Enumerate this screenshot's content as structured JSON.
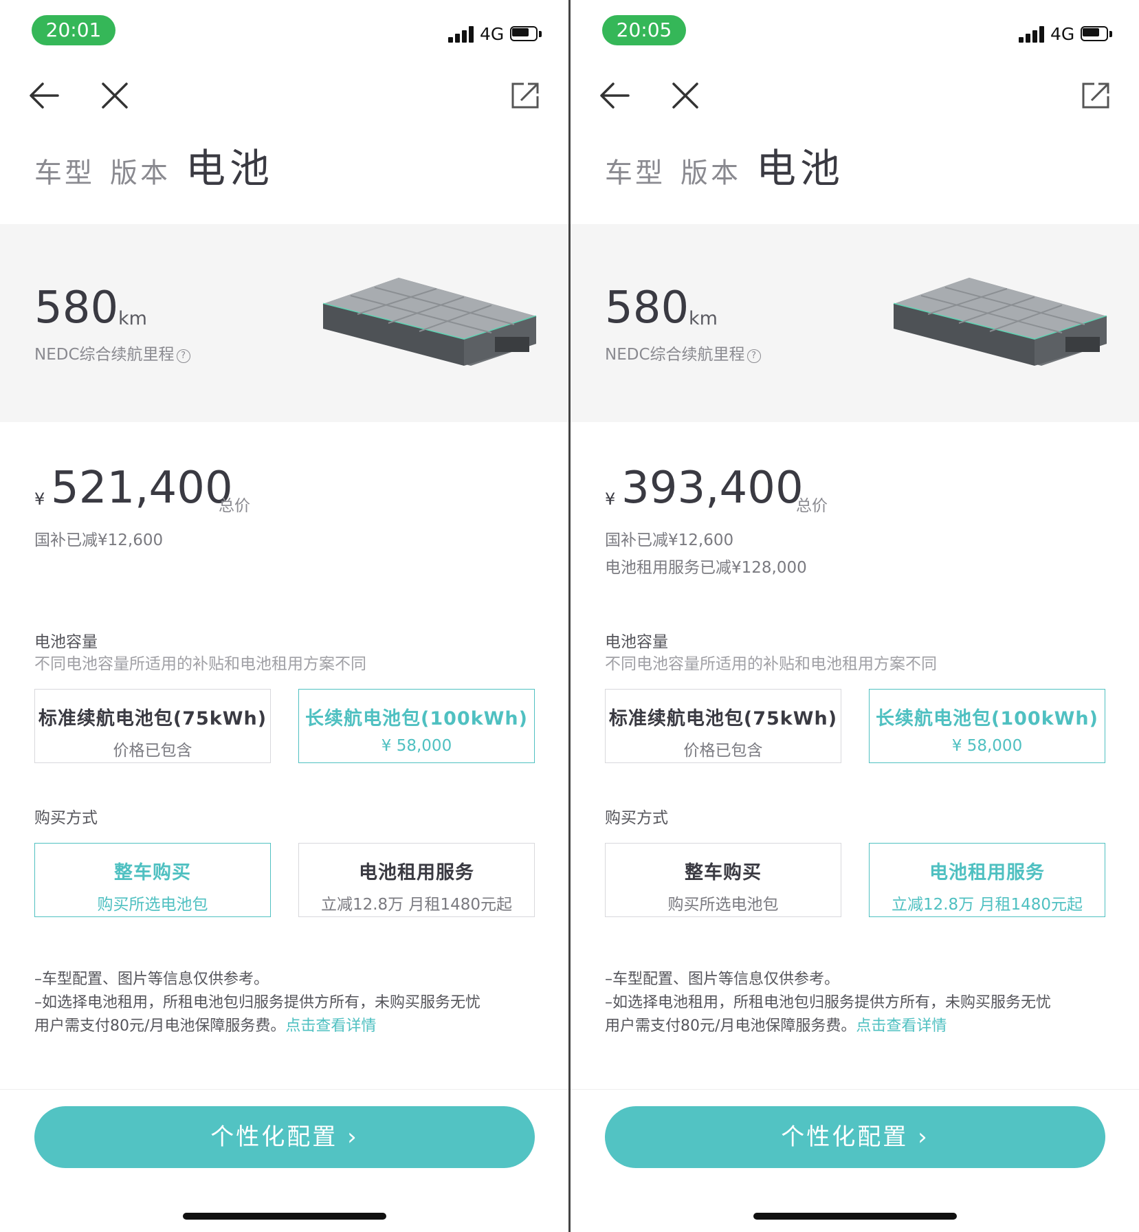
{
  "screens": [
    {
      "status": {
        "time": "20:01",
        "network": "4G"
      },
      "tabs": [
        "车型",
        "版本",
        "电池"
      ],
      "range": {
        "value": "580",
        "unit": "km",
        "label": "NEDC综合续航里程",
        "help": "?"
      },
      "price": {
        "currency": "¥",
        "amount": "521,400",
        "label": "总价",
        "notes": [
          "国补已减¥12,600"
        ]
      },
      "capacity": {
        "title": "电池容量",
        "subtitle": "不同电池容量所适用的补贴和电池租用方案不同",
        "options": [
          {
            "title": "标准续航电池包(75kWh)",
            "sub": "价格已包含",
            "selected": false
          },
          {
            "title": "长续航电池包(100kWh)",
            "sub": "¥ 58,000",
            "selected": true
          }
        ]
      },
      "purchase": {
        "title": "购买方式",
        "options": [
          {
            "title": "整车购买",
            "sub": "购买所选电池包",
            "selected": true
          },
          {
            "title": "电池租用服务",
            "sub": "立减12.8万  月租1480元起",
            "selected": false
          }
        ]
      },
      "disclaimer": {
        "line1": "–车型配置、图片等信息仅供参考。",
        "line2": "–如选择电池租用，所租电池包归服务提供方所有，未购买服务无忧",
        "line3": "用户需支付80元/月电池保障服务费。",
        "link": "点击查看详情"
      },
      "cta": "个性化配置 ›"
    },
    {
      "status": {
        "time": "20:05",
        "network": "4G"
      },
      "tabs": [
        "车型",
        "版本",
        "电池"
      ],
      "range": {
        "value": "580",
        "unit": "km",
        "label": "NEDC综合续航里程",
        "help": "?"
      },
      "price": {
        "currency": "¥",
        "amount": "393,400",
        "label": "总价",
        "notes": [
          "国补已减¥12,600",
          "电池租用服务已减¥128,000"
        ]
      },
      "capacity": {
        "title": "电池容量",
        "subtitle": "不同电池容量所适用的补贴和电池租用方案不同",
        "options": [
          {
            "title": "标准续航电池包(75kWh)",
            "sub": "价格已包含",
            "selected": false
          },
          {
            "title": "长续航电池包(100kWh)",
            "sub": "¥ 58,000",
            "selected": true
          }
        ]
      },
      "purchase": {
        "title": "购买方式",
        "options": [
          {
            "title": "整车购买",
            "sub": "购买所选电池包",
            "selected": false
          },
          {
            "title": "电池租用服务",
            "sub": "立减12.8万  月租1480元起",
            "selected": true
          }
        ]
      },
      "disclaimer": {
        "line1": "–车型配置、图片等信息仅供参考。",
        "line2": "–如选择电池租用，所租电池包归服务提供方所有，未购买服务无忧",
        "line3": "用户需支付80元/月电池保障服务费。",
        "link": "点击查看详情"
      },
      "cta": "个性化配置 ›"
    }
  ],
  "colors": {
    "accent": "#52c3c3",
    "time_pill": "#35b758",
    "panel_bg": "#f5f5f5"
  },
  "icons": [
    "back-arrow-icon",
    "close-icon",
    "share-icon",
    "signal-icon",
    "battery-icon",
    "help-icon",
    "chevron-right-icon"
  ]
}
